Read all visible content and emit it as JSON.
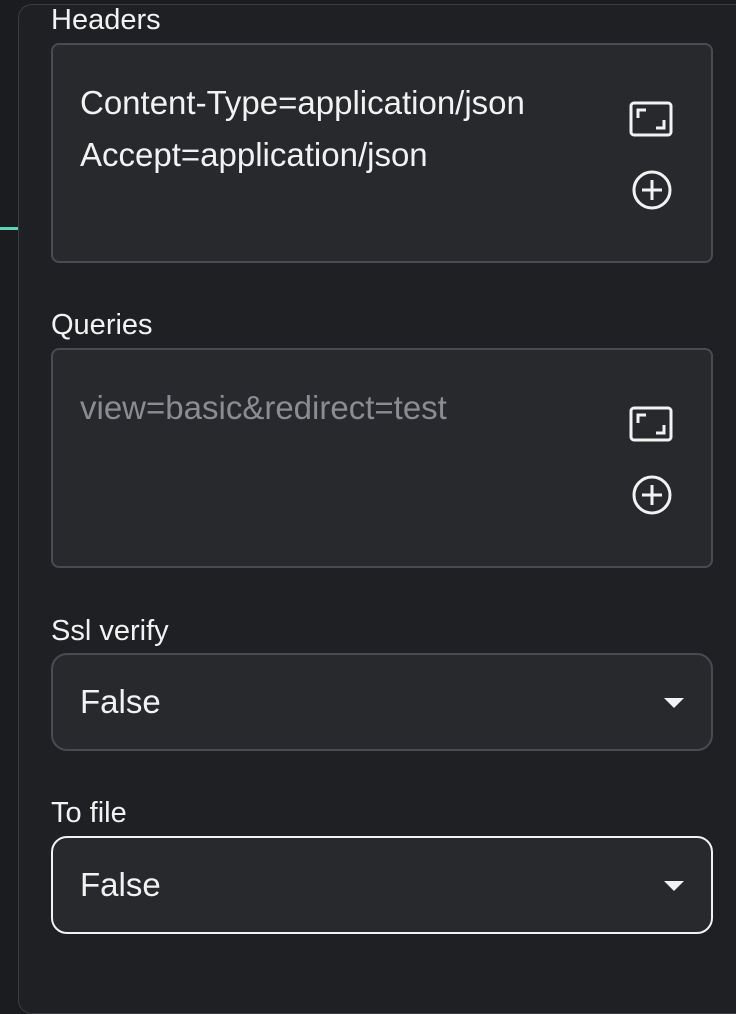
{
  "headers": {
    "label": "Headers",
    "lines": [
      "Content-Type=application/json",
      "Accept=application/json"
    ],
    "expand_icon": "expand-icon",
    "add_icon": "plus-circle-icon"
  },
  "queries": {
    "label": "Queries",
    "placeholder": "view=basic&redirect=test",
    "expand_icon": "expand-icon",
    "add_icon": "plus-circle-icon"
  },
  "ssl_verify": {
    "label": "Ssl verify",
    "value": "False"
  },
  "to_file": {
    "label": "To file",
    "value": "False"
  },
  "colors": {
    "background": "#1f2023",
    "field_bg": "#28292d",
    "field_border": "#4a4b50",
    "text": "#f2f2f2",
    "placeholder": "#8b8c91",
    "edge_accent": "#5fd3b5"
  }
}
